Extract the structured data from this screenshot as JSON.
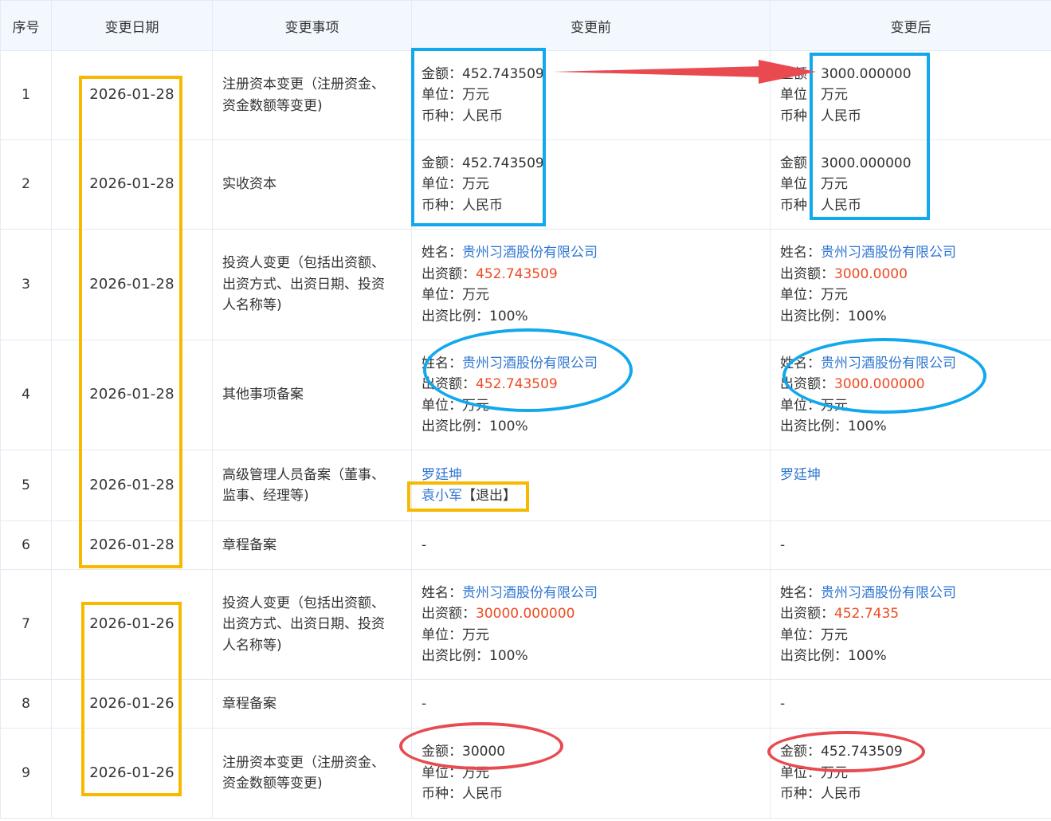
{
  "table": {
    "headers": [
      "序号",
      "变更日期",
      "变更事项",
      "变更前",
      "变更后"
    ],
    "rows": [
      {
        "no": "1",
        "date": "2026-01-28",
        "item": "注册资本变更（注册资金、资金数额等变更)",
        "before": [
          {
            "label": "金额：",
            "value": "452.743509"
          },
          {
            "label": "单位：",
            "value": "万元"
          },
          {
            "label": "币种：",
            "value": "人民币"
          }
        ],
        "after": [
          {
            "label": "金额：",
            "value": "3000.000000"
          },
          {
            "label": "单位：",
            "value": "万元"
          },
          {
            "label": "币种：",
            "value": "人民币"
          }
        ]
      },
      {
        "no": "2",
        "date": "2026-01-28",
        "item": "实收资本",
        "before": [
          {
            "label": "金额：",
            "value": "452.743509"
          },
          {
            "label": "单位：",
            "value": "万元"
          },
          {
            "label": "币种：",
            "value": "人民币"
          }
        ],
        "after": [
          {
            "label": "金额：",
            "value": "3000.000000"
          },
          {
            "label": "单位：",
            "value": "万元"
          },
          {
            "label": "币种：",
            "value": "人民币"
          }
        ]
      },
      {
        "no": "3",
        "date": "2026-01-28",
        "item": "投资人变更（包括出资额、出资方式、出资日期、投资人名称等)",
        "before": [
          {
            "label": "姓名：",
            "value": "贵州习酒股份有限公司"
          },
          {
            "label": "出资额：",
            "value": "452.743509"
          },
          {
            "label": "单位：",
            "value": "万元"
          },
          {
            "label": "出资比例：",
            "value": "100%"
          }
        ],
        "after": [
          {
            "label": "姓名：",
            "value": "贵州习酒股份有限公司"
          },
          {
            "label": "出资额：",
            "value": "3000.0000"
          },
          {
            "label": "单位：",
            "value": "万元"
          },
          {
            "label": "出资比例：",
            "value": "100%"
          }
        ]
      },
      {
        "no": "4",
        "date": "2026-01-28",
        "item": "其他事项备案",
        "before": [
          {
            "label": "姓名：",
            "value": "贵州习酒股份有限公司"
          },
          {
            "label": "出资额：",
            "value": "452.743509"
          },
          {
            "label": "单位：",
            "value": "万元"
          },
          {
            "label": "出资比例：",
            "value": "100%"
          }
        ],
        "after": [
          {
            "label": "姓名：",
            "value": "贵州习酒股份有限公司"
          },
          {
            "label": "出资额：",
            "value": "3000.000000"
          },
          {
            "label": "单位：",
            "value": "万元"
          },
          {
            "label": "出资比例：",
            "value": "100%"
          }
        ]
      },
      {
        "no": "5",
        "date": "2026-01-28",
        "item": "高级管理人员备案（董事、监事、经理等)",
        "before_people": [
          {
            "name": "罗廷坤",
            "tag": ""
          },
          {
            "name": "袁小军",
            "tag": "【退出】"
          }
        ],
        "after_people": [
          {
            "name": "罗廷坤",
            "tag": ""
          }
        ]
      },
      {
        "no": "6",
        "date": "2026-01-28",
        "item": "章程备案",
        "before": "-",
        "after": "-"
      },
      {
        "no": "7",
        "date": "2026-01-26",
        "item": "投资人变更（包括出资额、出资方式、出资日期、投资人名称等)",
        "before": [
          {
            "label": "姓名：",
            "value": "贵州习酒股份有限公司"
          },
          {
            "label": "出资额：",
            "value": "30000.000000"
          },
          {
            "label": "单位：",
            "value": "万元"
          },
          {
            "label": "出资比例：",
            "value": "100%"
          }
        ],
        "after": [
          {
            "label": "姓名：",
            "value": "贵州习酒股份有限公司"
          },
          {
            "label": "出资额：",
            "value": "452.7435"
          },
          {
            "label": "单位：",
            "value": "万元"
          },
          {
            "label": "出资比例：",
            "value": "100%"
          }
        ]
      },
      {
        "no": "8",
        "date": "2026-01-26",
        "item": "章程备案",
        "before": "-",
        "after": "-"
      },
      {
        "no": "9",
        "date": "2026-01-26",
        "item": "注册资本变更（注册资金、资金数额等变更)",
        "before": [
          {
            "label": "金额：",
            "value": "30000"
          },
          {
            "label": "单位：",
            "value": "万元"
          },
          {
            "label": "币种：",
            "value": "人民币"
          }
        ],
        "after": [
          {
            "label": "金额：",
            "value": "452.743509"
          },
          {
            "label": "单位：",
            "value": "万元"
          },
          {
            "label": "币种：",
            "value": "人民币"
          }
        ]
      }
    ]
  },
  "colors": {
    "header_bg": "#f2f8fd",
    "border": "#e3ebf3",
    "link": "#2f76d1",
    "amount_red": "#ee4a23",
    "annotation_yellow": "#f7b900",
    "annotation_blue": "#12a8ee",
    "annotation_red": "#e84a4f"
  }
}
